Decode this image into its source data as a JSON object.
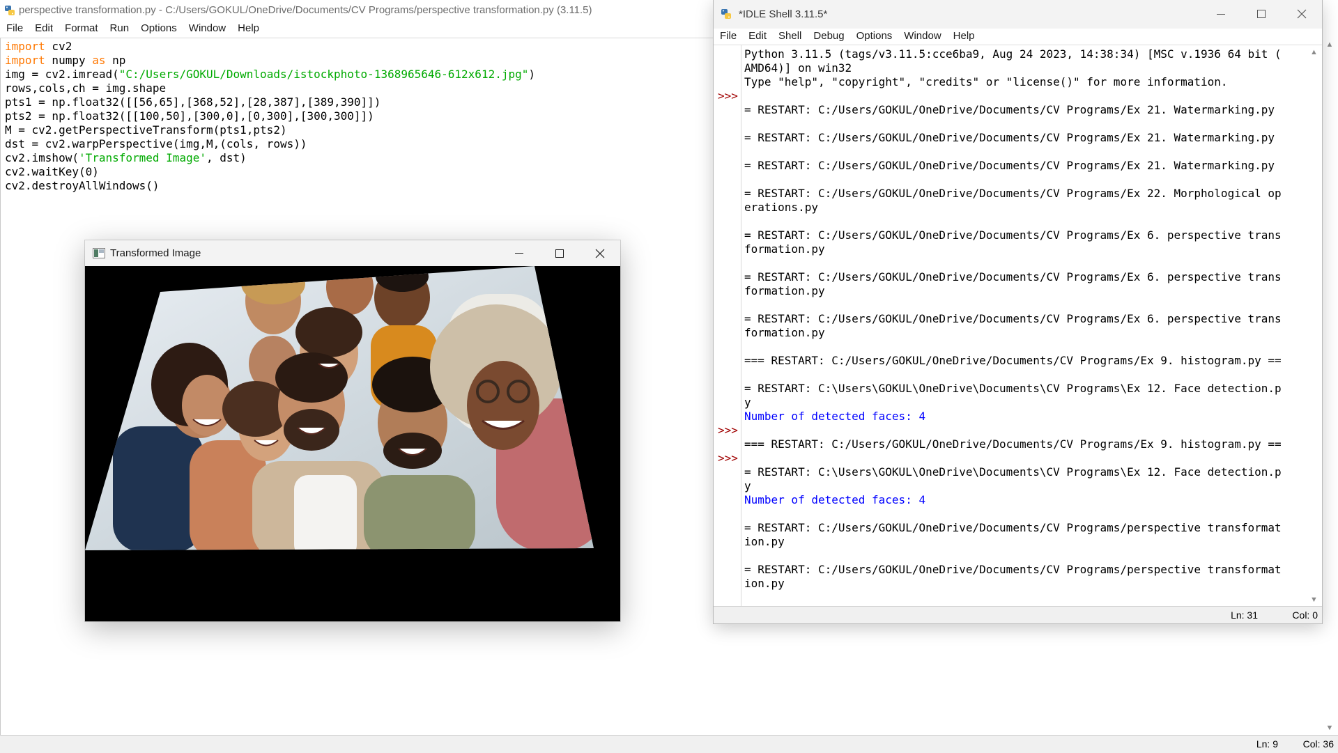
{
  "editor": {
    "title": "perspective transformation.py - C:/Users/GOKUL/OneDrive/Documents/CV Programs/perspective transformation.py (3.11.5)",
    "menu": [
      "File",
      "Edit",
      "Format",
      "Run",
      "Options",
      "Window",
      "Help"
    ],
    "code": {
      "l1_kw": "import",
      "l1_rest": " cv2",
      "l2_kw": "import",
      "l2_mid": " numpy ",
      "l2_kw2": "as",
      "l2_rest": " np",
      "l3_pre": "img = cv2.imread(",
      "l3_str": "\"C:/Users/GOKUL/Downloads/istockphoto-1368965646-612x612.jpg\"",
      "l3_post": ")",
      "l4": "rows,cols,ch = img.shape",
      "l5": "pts1 = np.float32([[56,65],[368,52],[28,387],[389,390]])",
      "l6": "pts2 = np.float32([[100,50],[300,0],[0,300],[300,300]])",
      "l7": "M = cv2.getPerspectiveTransform(pts1,pts2)",
      "l8": "dst = cv2.warpPerspective(img,M,(cols, rows))",
      "l9_pre": "cv2.imshow(",
      "l9_str": "'Transformed Image'",
      "l9_post": ", dst)",
      "l10": "cv2.waitKey(0)",
      "l11": "cv2.destroyAllWindows()"
    },
    "status": {
      "ln": "Ln: 9",
      "col": "Col: 36"
    }
  },
  "image_window": {
    "title": "Transformed Image"
  },
  "shell": {
    "title": "*IDLE Shell 3.11.5*",
    "menu": [
      "File",
      "Edit",
      "Shell",
      "Debug",
      "Options",
      "Window",
      "Help"
    ],
    "prompt": ">>>",
    "lines": [
      "Python 3.11.5 (tags/v3.11.5:cce6ba9, Aug 24 2023, 14:38:34) [MSC v.1936 64 bit (",
      "AMD64)] on win32",
      "Type \"help\", \"copyright\", \"credits\" or \"license()\" for more information.",
      "",
      "= RESTART: C:/Users/GOKUL/OneDrive/Documents/CV Programs/Ex 21. Watermarking.py",
      "",
      "= RESTART: C:/Users/GOKUL/OneDrive/Documents/CV Programs/Ex 21. Watermarking.py",
      "",
      "= RESTART: C:/Users/GOKUL/OneDrive/Documents/CV Programs/Ex 21. Watermarking.py",
      "",
      "= RESTART: C:/Users/GOKUL/OneDrive/Documents/CV Programs/Ex 22. Morphological op",
      "erations.py",
      "",
      "= RESTART: C:/Users/GOKUL/OneDrive/Documents/CV Programs/Ex 6. perspective trans",
      "formation.py",
      "",
      "= RESTART: C:/Users/GOKUL/OneDrive/Documents/CV Programs/Ex 6. perspective trans",
      "formation.py",
      "",
      "= RESTART: C:/Users/GOKUL/OneDrive/Documents/CV Programs/Ex 6. perspective trans",
      "formation.py",
      "",
      "=== RESTART: C:/Users/GOKUL/OneDrive/Documents/CV Programs/Ex 9. histogram.py ==",
      "",
      "= RESTART: C:\\Users\\GOKUL\\OneDrive\\Documents\\CV Programs\\Ex 12. Face detection.p",
      "y",
      "Number of detected faces: 4",
      "",
      "=== RESTART: C:/Users/GOKUL/OneDrive/Documents/CV Programs/Ex 9. histogram.py ==",
      "",
      "= RESTART: C:\\Users\\GOKUL\\OneDrive\\Documents\\CV Programs\\Ex 12. Face detection.p",
      "y",
      "Number of detected faces: 4",
      "",
      "= RESTART: C:/Users/GOKUL/OneDrive/Documents/CV Programs/perspective transformat",
      "ion.py",
      "",
      "= RESTART: C:/Users/GOKUL/OneDrive/Documents/CV Programs/perspective transformat",
      "ion.py"
    ],
    "status": {
      "ln": "Ln: 31",
      "col": "Col: 0"
    }
  }
}
